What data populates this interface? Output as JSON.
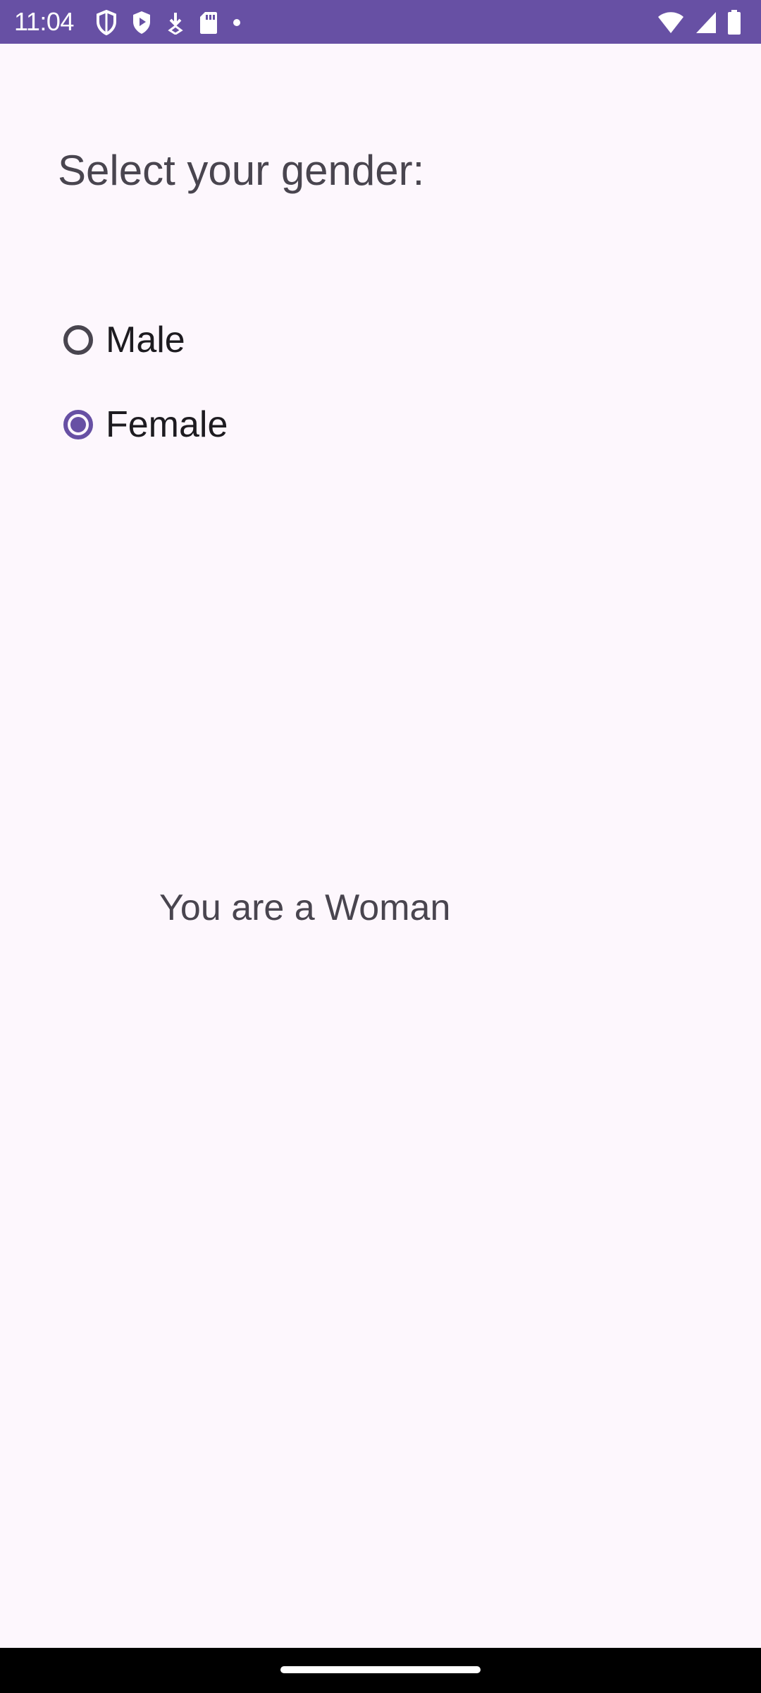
{
  "status_bar": {
    "time": "11:04",
    "left_icons": [
      "shield-icon",
      "play-protect-icon",
      "download-icon",
      "sd-card-icon",
      "dot-icon"
    ],
    "right_icons": [
      "wifi-icon",
      "signal-icon",
      "battery-icon"
    ],
    "background_color": "#6750a4"
  },
  "screen": {
    "prompt": "Select your gender:",
    "options": [
      {
        "label": "Male",
        "selected": false
      },
      {
        "label": "Female",
        "selected": true
      }
    ],
    "result": "You are a Woman",
    "accent_color": "#6750a4"
  }
}
